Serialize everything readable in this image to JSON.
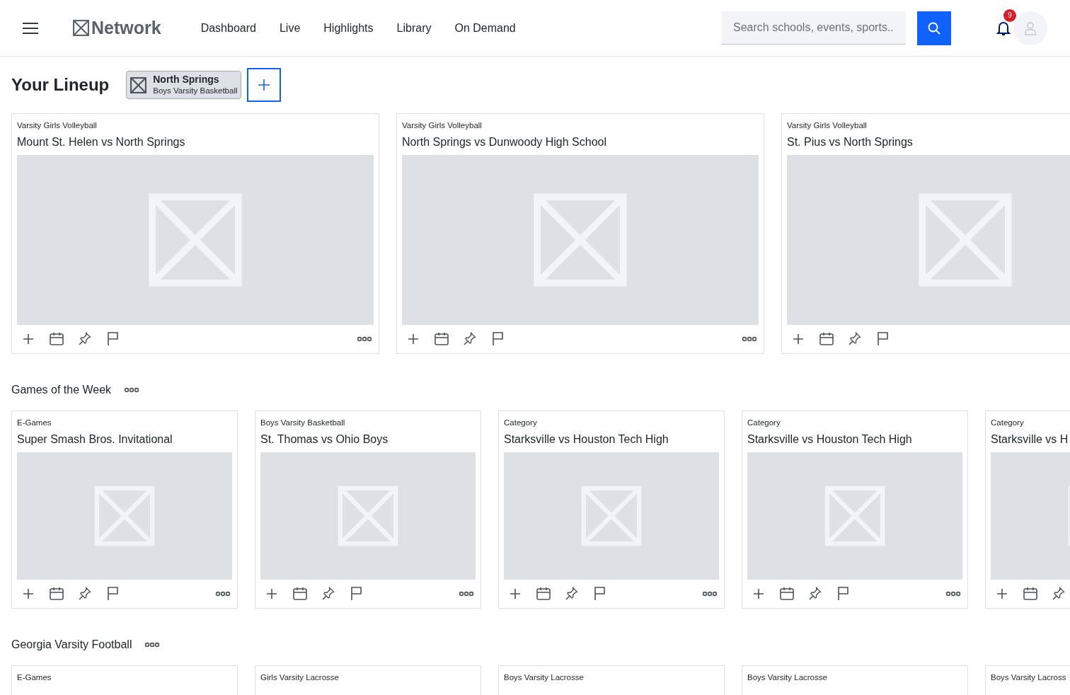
{
  "header": {
    "logo": "Network",
    "nav": [
      {
        "label": "Dashboard"
      },
      {
        "label": "Live"
      },
      {
        "label": "Highlights"
      },
      {
        "label": "Library"
      },
      {
        "label": "On Demand"
      }
    ],
    "search": {
      "placeholder": "Search schools, events, sports..."
    },
    "notifications": "9"
  },
  "lineup": {
    "title": "Your Lineup",
    "chips": [
      {
        "name": "North Springs",
        "subtitle": "Boys Varsity Basketball"
      }
    ],
    "cards": [
      {
        "category": "Varsity Girls Volleyball",
        "title": "Mount St. Helen vs North Springs",
        "actions": [
          {
            "kind": "add"
          },
          {
            "kind": "calendar"
          },
          {
            "kind": "pin"
          },
          {
            "kind": "flag"
          },
          {
            "kind": "more"
          }
        ]
      },
      {
        "category": "Varsity Girls Volleyball",
        "title": "North Springs vs Dunwoody High School",
        "actions": [
          {
            "kind": "add"
          },
          {
            "kind": "calendar"
          },
          {
            "kind": "pin"
          },
          {
            "kind": "flag"
          },
          {
            "kind": "more"
          }
        ]
      },
      {
        "category": "Varsity Girls Volleyball",
        "title": "St. Pius vs North Springs",
        "actions": [
          {
            "kind": "add"
          },
          {
            "kind": "calendar"
          },
          {
            "kind": "pin"
          },
          {
            "kind": "flag"
          }
        ]
      }
    ]
  },
  "sections": [
    {
      "title": "Games of the Week",
      "cards": [
        {
          "category": "E-Games",
          "title": "Super Smash Bros. Invitational",
          "actions": [
            {
              "kind": "add"
            },
            {
              "kind": "calendar"
            },
            {
              "kind": "pin"
            },
            {
              "kind": "flag"
            },
            {
              "kind": "more"
            }
          ]
        },
        {
          "category": "Boys Varsity Basketball",
          "title": "St. Thomas vs Ohio Boys",
          "actions": [
            {
              "kind": "add"
            },
            {
              "kind": "calendar"
            },
            {
              "kind": "pin"
            },
            {
              "kind": "flag"
            },
            {
              "kind": "more"
            }
          ]
        },
        {
          "category": "Category",
          "title": "Starksville vs Houston Tech High",
          "actions": [
            {
              "kind": "add"
            },
            {
              "kind": "calendar"
            },
            {
              "kind": "pin"
            },
            {
              "kind": "flag"
            },
            {
              "kind": "more"
            }
          ]
        },
        {
          "category": "Category",
          "title": "Starksville vs Houston Tech High",
          "actions": [
            {
              "kind": "add"
            },
            {
              "kind": "calendar"
            },
            {
              "kind": "pin"
            },
            {
              "kind": "flag"
            },
            {
              "kind": "more"
            }
          ]
        },
        {
          "category": "Category",
          "title": "Starksville vs H",
          "actions": [
            {
              "kind": "add"
            },
            {
              "kind": "calendar"
            },
            {
              "kind": "pin"
            }
          ]
        }
      ]
    },
    {
      "title": "Georgia Varsity Football",
      "cards": [
        {
          "category": "E-Games"
        },
        {
          "category": "Girls Varsity Lacrosse"
        },
        {
          "category": "Boys Varsity Lacrosse"
        },
        {
          "category": "Boys Varsity Lacrosse"
        },
        {
          "category": "Boys Varsity Lacross"
        }
      ]
    }
  ]
}
